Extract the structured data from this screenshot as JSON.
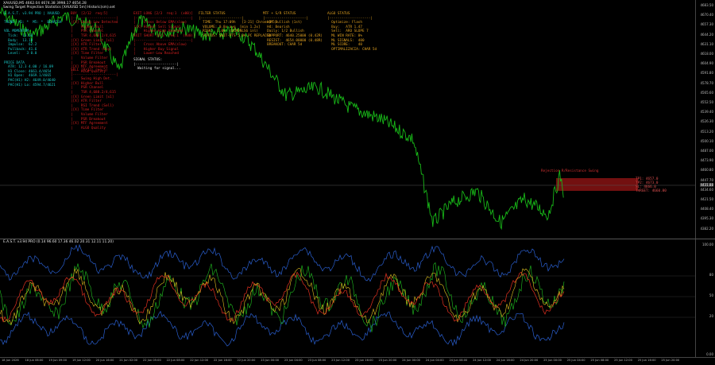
{
  "header": {
    "line1": "XAUUSD,M5  4662.04 4674.38 3998.17 4654.28",
    "line2": "Swing Target Projection Statistics [XAUUSD 5m] Historic(sm).set"
  },
  "panels": {
    "status": {
      "color": "#19c6c6",
      "lines": [
        "E.A.S.T. v3.94 PRO | XAUUSD",
        "",
        "TREND: H1: *  M5: *  BEARISH",
        "",
        "VOL MOMENTUM",
        "  Tick:  13.60",
        "  Body:  13.18",
        "  Impulse:  62.2",
        "  Pullback: 41.6",
        "  Level:   3 0.0",
        "",
        "PRICE DATA",
        "  ATR: 12.3 4.00 / 16.09",
        "  H1 Close: 4661.4/4654",
        "  H1 Open:  4669.1/4665",
        "  PAC(H1) H2: 4649.0/4640",
        "  PAC(H1) Lo: 4594.7/4621"
      ]
    },
    "buy": {
      "color": "#d62020",
      "lines": [
        "BUY  [2/12  req:5]",
        "|---------------------|",
        "|[X] Swing Low Detected",
        "|    Higher Bull",
        "|    PSR Channel",
        "|    TSR 4,688.2/4,615",
        "|[X] Green Limit [x1]",
        "|[X] ATR Filter",
        "|[X] ATR Trend (Buy)",
        "|[X] Time Filter",
        "|    Volume Filter",
        "|    PSR Breakout",
        "|[X] MTF Agreement",
        "|    ALGO Quality"
      ]
    },
    "sell": {
      "color": "#d62020",
      "lines": [
        "SELL [8/12  req:5]",
        "|---------------------|",
        "|    Swing High Det.",
        "|[X] Higher Bull",
        "|    PSR Channel",
        "|    TSR 4,688.2/4,615",
        "|[X] Green Limit [x1]",
        "|[X] ATR Filter",
        "|    RSI Trend (Sell)",
        "|[X] Time Filter",
        "|    Volume Filter",
        "|    PSR Breakout",
        "|[X] MTF Agreement",
        "|    ALGO Quality"
      ]
    },
    "exit_long": {
      "color": "#d62020",
      "lines": [
        "EXIT LONG [2/3  req:1  (x00)]",
        "|---------------------------|",
        "|    Cross Below EMA(slow)",
        "|[X] Higher Sell Signal",
        "|    Higher-High Reached"
      ]
    },
    "exit_short": {
      "color": "#d62020",
      "lines": [
        "EXIT SHORT [0/3  req:1  (x00)]",
        "|---------------------------|",
        "|    Cross Above EMA(slow)",
        "|    Higher Buy Signal",
        "|    Lower-Low Reached"
      ]
    },
    "signal": {
      "color": "#e6e6e6",
      "lines": [
        "SIGNAL STATUS:",
        "|--------------------|",
        "  Waiting for signal..."
      ]
    },
    "filter": {
      "color": "#e0a020",
      "lines": [
        "FILTER STATUS",
        "|--------------------|",
        "  TIME: Thu 17:09h   [3-21] Chrono(M5)",
        "  VOLUME: 0.8x avg  [min 1.2x]",
        "  RISK:  1.0%  (BCMONLS6 inl)",
        "  STATUS: SWIT-PTS 5.0% PC REPLACED"
      ]
    },
    "mtf": {
      "color": "#e0a020",
      "lines": [
        "MTF + S/R STATUS",
        "|--------------------|",
        "  H1: Bullish (1st)",
        "  H4: Bearish",
        "  Daily: 1/2 Bullish",
        "  SUPPORT: 4640.25000 (0.42R)",
        "  RESIST:  4654.00000 (0.48R)",
        "  BREAKOUT: CHAR 5d"
      ]
    },
    "algo": {
      "color": "#e0a020",
      "lines": [
        "ALGO STATUS",
        "|--------------------|",
        "  Optimize: Flash",
        "  Buy:   ATR 1.47",
        "  Sell:  ARO SLOPE 7",
        "  ML WIN RATE: 0%",
        "  ML SIGNALS:  400",
        "  ML SCORE:    40",
        "  OPTIMALIZACIA: CHAR 5d"
      ]
    }
  },
  "chart": {
    "bull_color": "#18b818",
    "zone_label": "Rejection R/Resistance Swing",
    "zone_color": "#c02020",
    "zone_lines": [
      "TP1: 4657.0",
      "TP2: 4673.0",
      "SL: 4666.0",
      "TARGET: 4660.00"
    ],
    "price_ticks": [
      "4683.50",
      "4670.40",
      "4657.30",
      "4644.20",
      "4631.10",
      "4618.00",
      "4604.90",
      "4591.80",
      "4578.70",
      "4565.60",
      "4552.50",
      "4539.40",
      "4526.30",
      "4513.20",
      "4500.10",
      "4487.00",
      "4473.90",
      "4460.80",
      "4447.70",
      "4434.60",
      "4421.50",
      "4408.40",
      "4395.30",
      "4382.20"
    ],
    "current_price": "4431.88"
  },
  "oscillator": {
    "header": "E.A.S.T. v3.94 PRO (0.14 96.60 17.36 46.02 20.31 12.11 11.20)",
    "levels": [
      "100.00",
      "80",
      "50",
      "20",
      "0.00"
    ]
  },
  "time_axis": [
    "18 Jun 2026",
    "18 Jun 06:00",
    "19 Jun 09:00",
    "19 Jun 12:00",
    "20 Jun 16:00",
    "21 Jun 02:00",
    "22 Jun 05:00",
    "22 Jun 08:00",
    "22 Jun 12:00",
    "22 Jun 16:00",
    "22 Jun 20:00",
    "23 Jun 00:00",
    "23 Jun 04:00",
    "23 Jun 08:00",
    "23 Jun 12:00",
    "23 Jun 16:00",
    "23 Jun 20:00",
    "24 Jun 00:00",
    "24 Jun 04:00",
    "24 Jun 08:00",
    "24 Jun 12:00",
    "24 Jun 16:00",
    "24 Jun 20:00",
    "25 Jun 00:00",
    "25 Jun 04:00",
    "25 Jun 08:00",
    "25 Jun 12:00",
    "25 Jun 16:00",
    "25 Jun 20:00"
  ]
}
